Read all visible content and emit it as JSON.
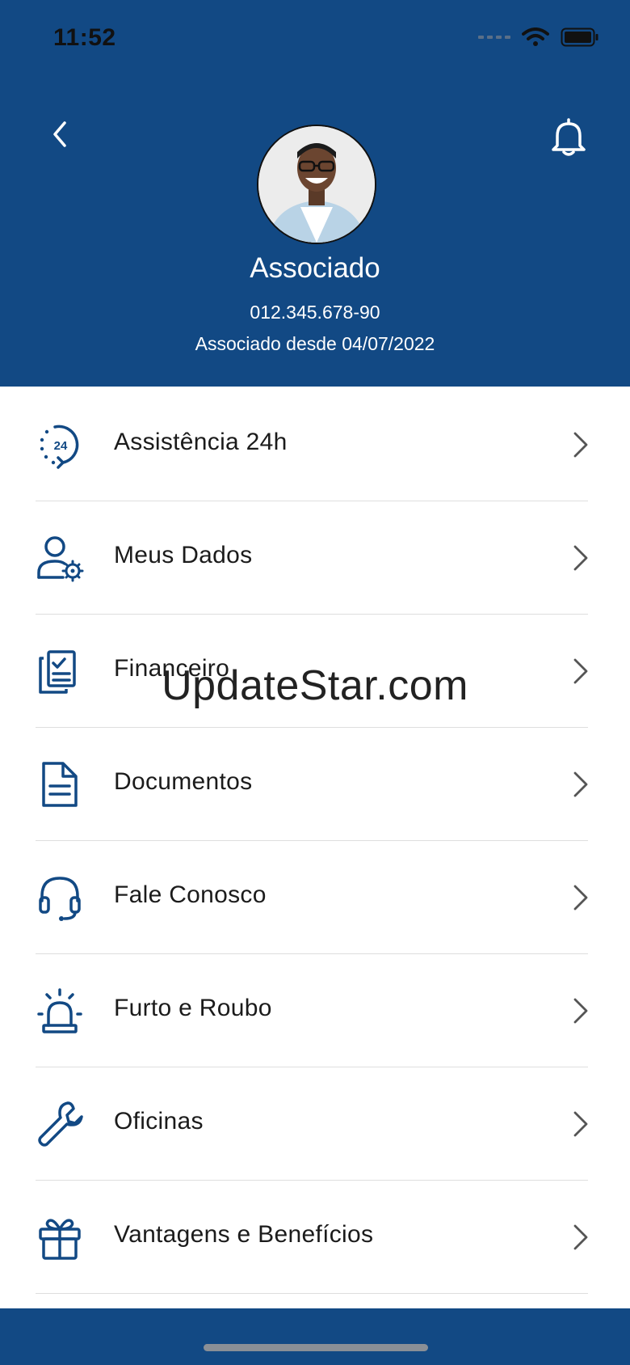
{
  "status": {
    "time": "11:52"
  },
  "profile": {
    "name": "Associado",
    "cpf": "012.345.678-90",
    "since": "Associado desde 04/07/2022"
  },
  "menu": [
    {
      "label": "Assistência 24h",
      "icon": "assistance-24h-icon"
    },
    {
      "label": "Meus Dados",
      "icon": "user-settings-icon"
    },
    {
      "label": "Financeiro",
      "icon": "financial-clipboard-icon"
    },
    {
      "label": "Documentos",
      "icon": "document-icon"
    },
    {
      "label": "Fale Conosco",
      "icon": "headset-icon"
    },
    {
      "label": "Furto e Roubo",
      "icon": "alarm-siren-icon"
    },
    {
      "label": "Oficinas",
      "icon": "wrench-icon"
    },
    {
      "label": "Vantagens e Benefícios",
      "icon": "gift-icon"
    }
  ],
  "watermark": "UpdateStar.com",
  "colors": {
    "brand": "#124984",
    "icon": "#124984"
  }
}
